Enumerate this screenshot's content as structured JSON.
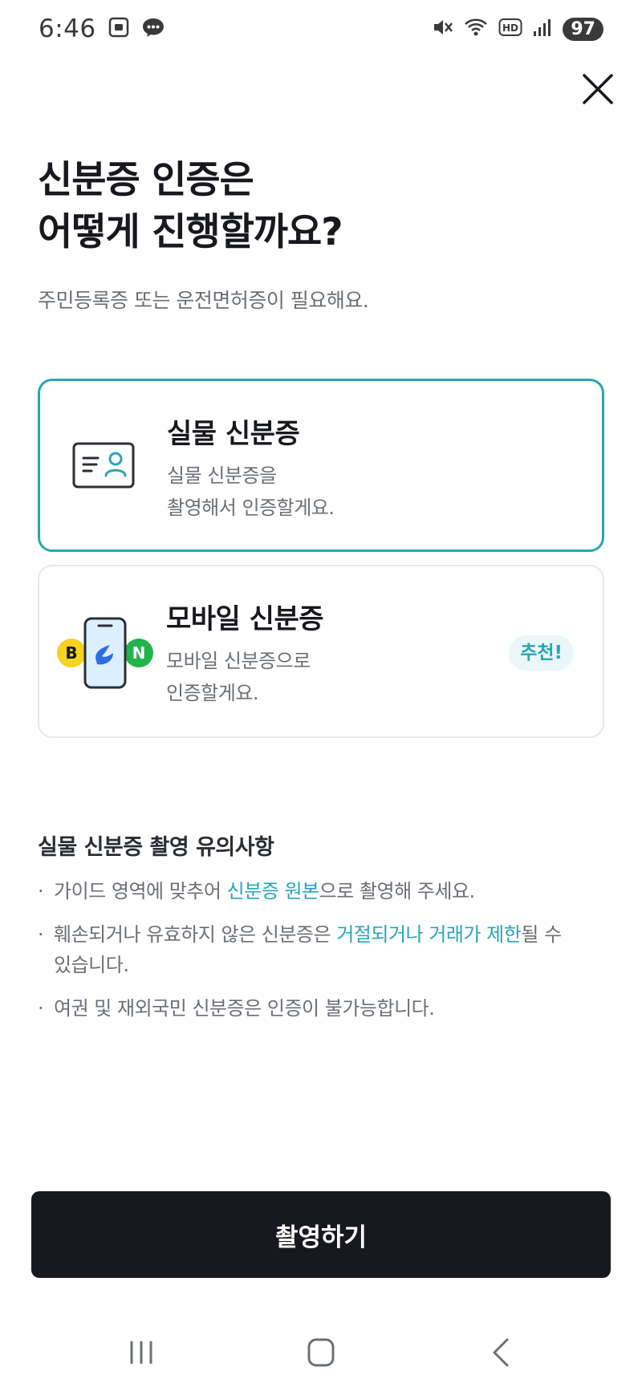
{
  "status_bar": {
    "time": "6:46",
    "battery": "97",
    "icons": [
      "screenshot-icon",
      "chat-bubble-icon",
      "mute-icon",
      "wifi-icon",
      "hd-icon",
      "signal-icon"
    ]
  },
  "header": {
    "close_icon": "close-icon"
  },
  "title": {
    "line1": "신분증 인증은",
    "line2": "어떻게 진행할까요?",
    "subtitle": "주민등록증 또는 운전면허증이 필요해요."
  },
  "options": {
    "physical": {
      "title": "실물 신분증",
      "desc_line1": "실물 신분증을",
      "desc_line2": "촬영해서 인증할게요.",
      "icon": "id-card-icon",
      "selected": true
    },
    "mobile": {
      "title": "모바일 신분증",
      "desc_line1": "모바일 신분증으로",
      "desc_line2": "인증할게요.",
      "icon": "mobile-id-icon",
      "badge": "추천!",
      "icon_letter_left": "B",
      "icon_letter_right": "N"
    }
  },
  "notice": {
    "title": "실물 신분증 촬영 유의사항",
    "items": [
      {
        "pre": "가이드 영역에 맞추어 ",
        "highlight": "신분증 원본",
        "post": "으로 촬영해 주세요."
      },
      {
        "pre": "훼손되거나 유효하지 않은 신분증은 ",
        "highlight": "거절되거나 거래가 제한",
        "post": "될 수 있습니다."
      },
      {
        "pre": "여권 및 재외국민 신분증은 인증이 불가능합니다.",
        "highlight": "",
        "post": ""
      }
    ]
  },
  "primary_action": {
    "label": "촬영하기"
  },
  "nav_bar": {
    "icons": [
      "recent-apps-icon",
      "home-icon",
      "back-icon"
    ]
  },
  "colors": {
    "accent": "#27a6b6",
    "primary_button": "#17191e",
    "text_secondary": "#6b6f76",
    "card_border": "#e6e8eb",
    "badge_bg": "#eaf6f8"
  }
}
